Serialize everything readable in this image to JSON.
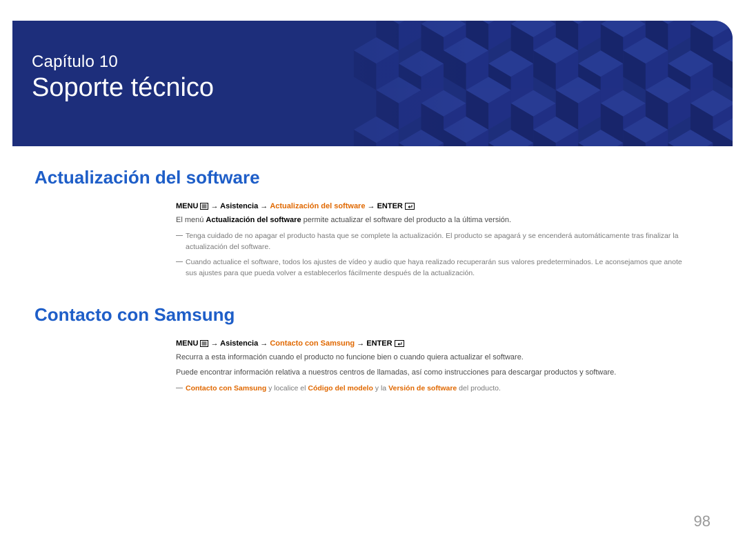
{
  "banner": {
    "chapter_label": "Capítulo 10",
    "chapter_title": "Soporte técnico"
  },
  "sections": {
    "s1": {
      "title": "Actualización del software",
      "menu": {
        "prefix": "MENU",
        "path1": " → Asistencia → ",
        "highlight": "Actualización del software",
        "path2": " → ENTER"
      },
      "line1_a": "El menú ",
      "line1_bold": "Actualización del software",
      "line1_b": " permite actualizar el software del producto a la última versión.",
      "note1": "Tenga cuidado de no apagar el producto hasta que se complete la actualización. El producto se apagará y se encenderá automáticamente tras finalizar la actualización del software.",
      "note2": "Cuando actualice el software, todos los ajustes de vídeo y audio que haya realizado recuperarán sus valores predeterminados. Le aconsejamos que anote sus ajustes para que pueda volver a establecerlos fácilmente después de la actualización."
    },
    "s2": {
      "title": "Contacto con Samsung",
      "menu": {
        "prefix": "MENU",
        "path1": " → Asistencia → ",
        "highlight": "Contacto con Samsung",
        "path2": " → ENTER"
      },
      "line1": "Recurra a esta información cuando el producto no funcione bien o cuando quiera actualizar el software.",
      "line2": "Puede encontrar información relativa a nuestros centros de llamadas, así como instrucciones para descargar productos y software.",
      "note1_a": "Contacto con Samsung",
      "note1_b": " y localice el ",
      "note1_c": "Código del modelo",
      "note1_d": " y la ",
      "note1_e": "Versión de software",
      "note1_f": " del producto."
    }
  },
  "page_number": "98"
}
